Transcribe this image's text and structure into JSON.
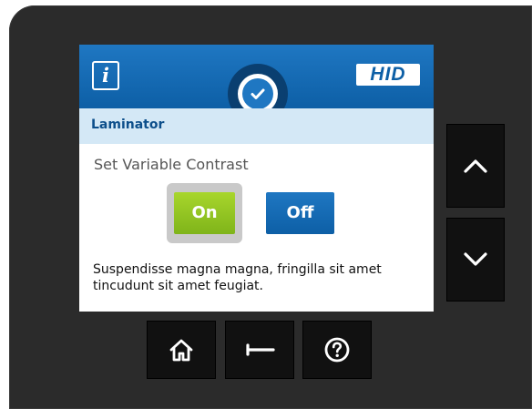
{
  "header": {
    "info_icon": "info-icon",
    "info_glyph": "i",
    "brand_logo": "HID",
    "status_icon": "check-icon"
  },
  "section": {
    "title": "Laminator"
  },
  "setting": {
    "label": "Set Variable Contrast",
    "selected": "On",
    "on_label": "On",
    "off_label": "Off"
  },
  "description": "Suspendisse magna magna, fringilla sit amet tincudunt sit amet feugiat.",
  "nav": {
    "up_icon": "chevron-up-icon",
    "down_icon": "chevron-down-icon",
    "home_icon": "home-icon",
    "back_icon": "back-arrow-icon",
    "help_icon": "help-icon"
  },
  "colors": {
    "primary_blue": "#0d5fa6",
    "light_blue": "#d4e8f6",
    "on_green": "#8cc21f",
    "bezel": "#2b2b2b"
  }
}
